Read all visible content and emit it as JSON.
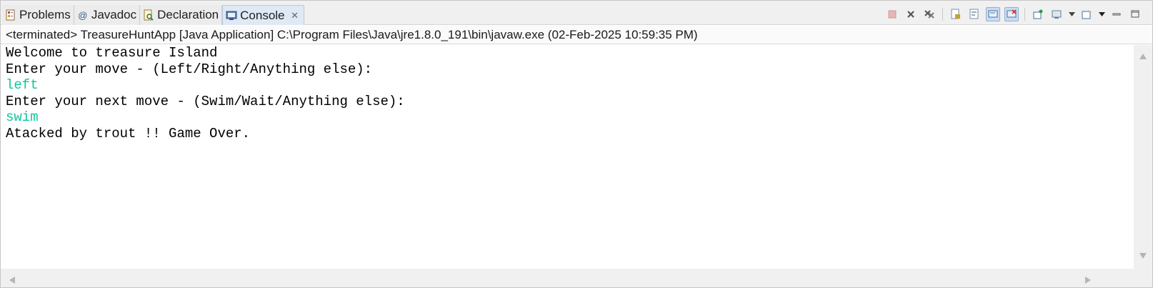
{
  "tabs": [
    {
      "label": "Problems",
      "icon": "problems-icon"
    },
    {
      "label": "Javadoc",
      "icon": "javadoc-icon"
    },
    {
      "label": "Declaration",
      "icon": "declaration-icon"
    },
    {
      "label": "Console",
      "icon": "console-icon",
      "active": true,
      "close": "✕"
    }
  ],
  "toolbar": {
    "buttons": [
      "terminate-icon",
      "remove-launch-icon",
      "remove-all-terminated-icon",
      "scroll-lock-icon",
      "word-wrap-icon",
      "show-on-stdout-icon",
      "show-on-stderr-icon",
      "pin-console-icon",
      "display-selected-console-icon",
      "open-console-icon",
      "view-menu-icon",
      "minimize-icon",
      "maximize-icon"
    ]
  },
  "status": {
    "text": "<terminated> TreasureHuntApp [Java Application] C:\\Program Files\\Java\\jre1.8.0_191\\bin\\javaw.exe (02-Feb-2025 10:59:35 PM)"
  },
  "console": {
    "lines": [
      {
        "text": "Welcome to treasure Island",
        "kind": "output"
      },
      {
        "text": "Enter your move - (Left/Right/Anything else):",
        "kind": "output"
      },
      {
        "text": "left",
        "kind": "input"
      },
      {
        "text": "Enter your next move - (Swim/Wait/Anything else):",
        "kind": "output"
      },
      {
        "text": "swim",
        "kind": "input"
      },
      {
        "text": "Atacked by trout !! Game Over.",
        "kind": "output"
      }
    ]
  },
  "colors": {
    "input_text": "#11c79a",
    "active_tab": "#dfe9f5"
  }
}
